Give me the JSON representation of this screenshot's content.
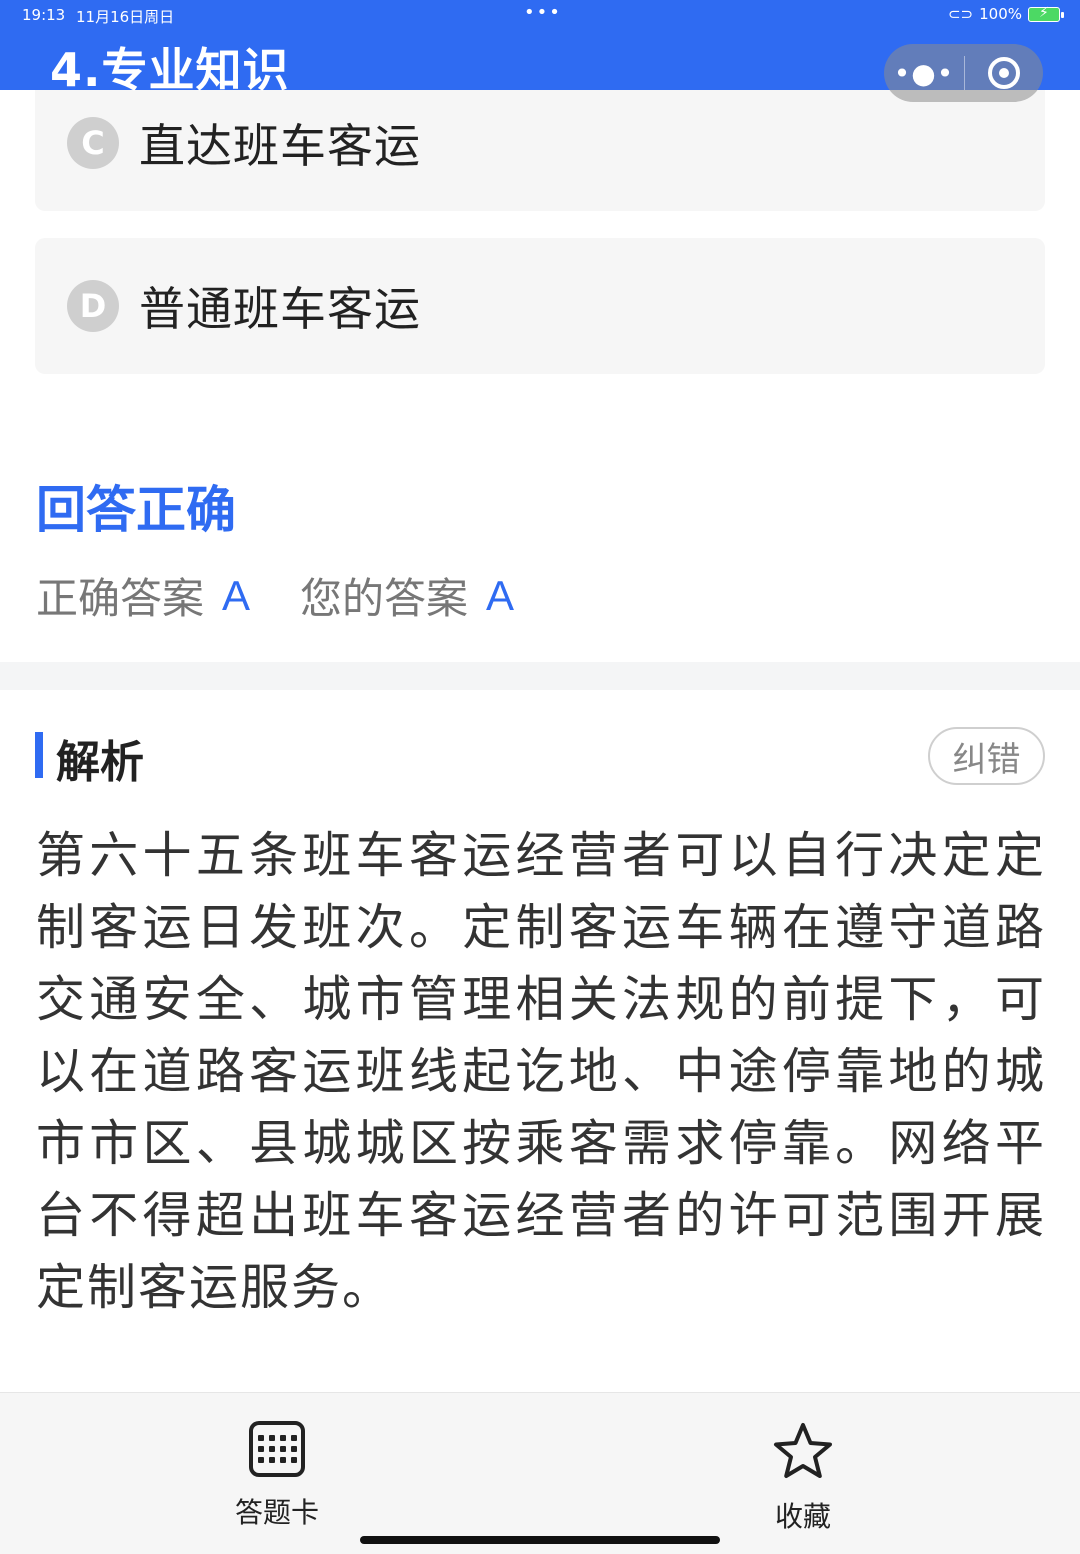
{
  "status": {
    "time": "19:13",
    "date": "11月16日周日",
    "battery": "100%"
  },
  "header": {
    "title": "4.专业知识"
  },
  "options": [
    {
      "letter": "C",
      "text": "直达班车客运"
    },
    {
      "letter": "D",
      "text": "普通班车客运"
    }
  ],
  "result": {
    "title": "回答正确",
    "correct_label": "正确答案",
    "correct_value": "A",
    "yours_label": "您的答案",
    "yours_value": "A"
  },
  "analysis": {
    "title": "解析",
    "report_button": "纠错",
    "text": "第六十五条班车客运经营者可以自行决定定制客运日发班次。定制客运车辆在遵守道路交通安全、城市管理相关法规的前提下，可以在道路客运班线起讫地、中途停靠地的城市市区、县城城区按乘客需求停靠。网络平台不得超出班车客运经营者的许可范围开展定制客运服务。"
  },
  "bottom": {
    "answer_card": "答题卡",
    "favorite": "收藏"
  },
  "colors": {
    "primary": "#2f6bf2"
  }
}
